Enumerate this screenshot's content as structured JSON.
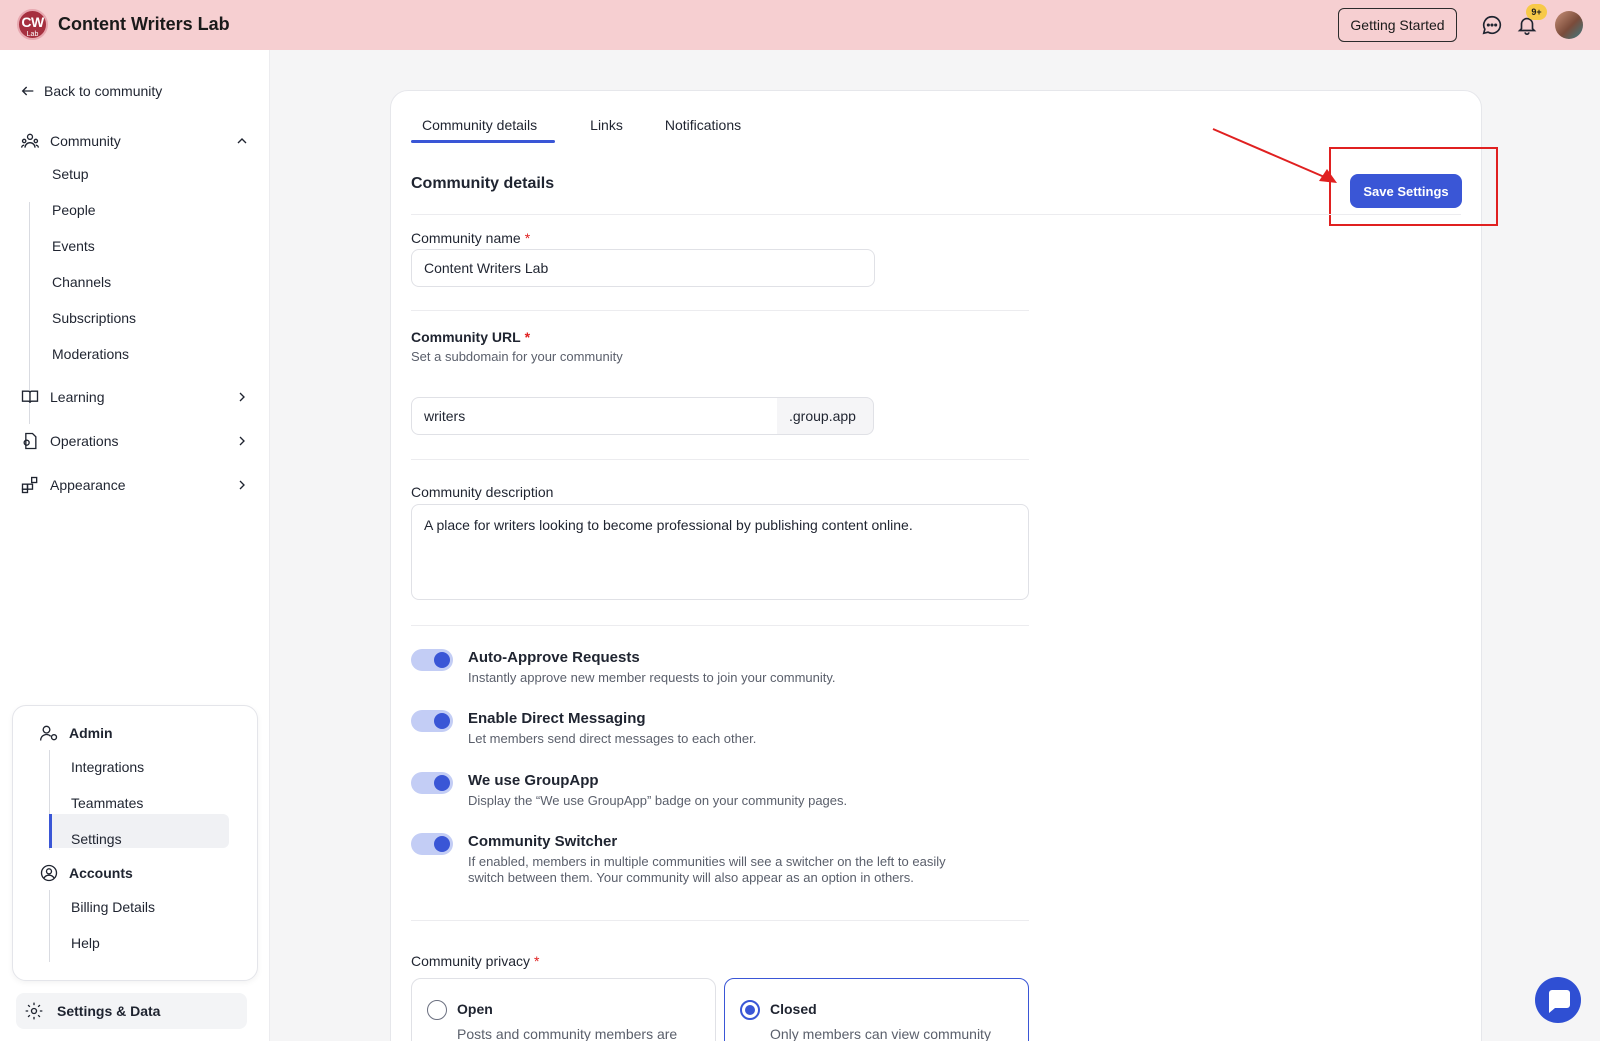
{
  "app": {
    "logo_main": "CW",
    "logo_sub": "Lab",
    "title": "Content Writers Lab",
    "getting_started": "Getting Started",
    "notif_badge": "9+"
  },
  "sidebar": {
    "back": "Back to community",
    "community": {
      "label": "Community",
      "items": [
        "Setup",
        "People",
        "Events",
        "Channels",
        "Subscriptions",
        "Moderations"
      ]
    },
    "learning": "Learning",
    "operations": "Operations",
    "appearance": "Appearance",
    "admin": {
      "label": "Admin",
      "items": [
        "Integrations",
        "Teammates",
        "Settings"
      ]
    },
    "accounts": {
      "label": "Accounts",
      "items": [
        "Billing Details",
        "Help"
      ]
    },
    "settings_data": "Settings & Data"
  },
  "tabs": [
    "Community details",
    "Links",
    "Notifications"
  ],
  "main": {
    "section_title": "Community details",
    "save_label": "Save Settings",
    "name_label": "Community name",
    "name_value": "Content Writers Lab",
    "url_label": "Community URL",
    "url_help": "Set a subdomain for your community",
    "url_value": "writers",
    "url_suffix": ".group.app",
    "desc_label": "Community description",
    "desc_value": "A place for writers looking to become professional by publishing content online.",
    "required_mark": "*",
    "toggles": [
      {
        "title": "Auto-Approve Requests",
        "desc": "Instantly approve new member requests to join your community.",
        "on": true
      },
      {
        "title": "Enable Direct Messaging",
        "desc": "Let members send direct messages to each other.",
        "on": true
      },
      {
        "title": "We use GroupApp",
        "desc": "Display the “We use GroupApp” badge on your community pages.",
        "on": true
      },
      {
        "title": "Community Switcher",
        "desc": "If enabled, members in multiple communities will see a switcher on the left to easily switch between them. Your community will also appear as an option in others.",
        "on": true
      }
    ],
    "privacy_label": "Community privacy",
    "privacy": [
      {
        "title": "Open",
        "desc": "Posts and community members are",
        "selected": false
      },
      {
        "title": "Closed",
        "desc": "Only members can view community",
        "selected": true
      }
    ]
  },
  "colors": {
    "accent": "#3a56d6",
    "topbar": "#f6cfd1",
    "highlight": "#e02020"
  }
}
